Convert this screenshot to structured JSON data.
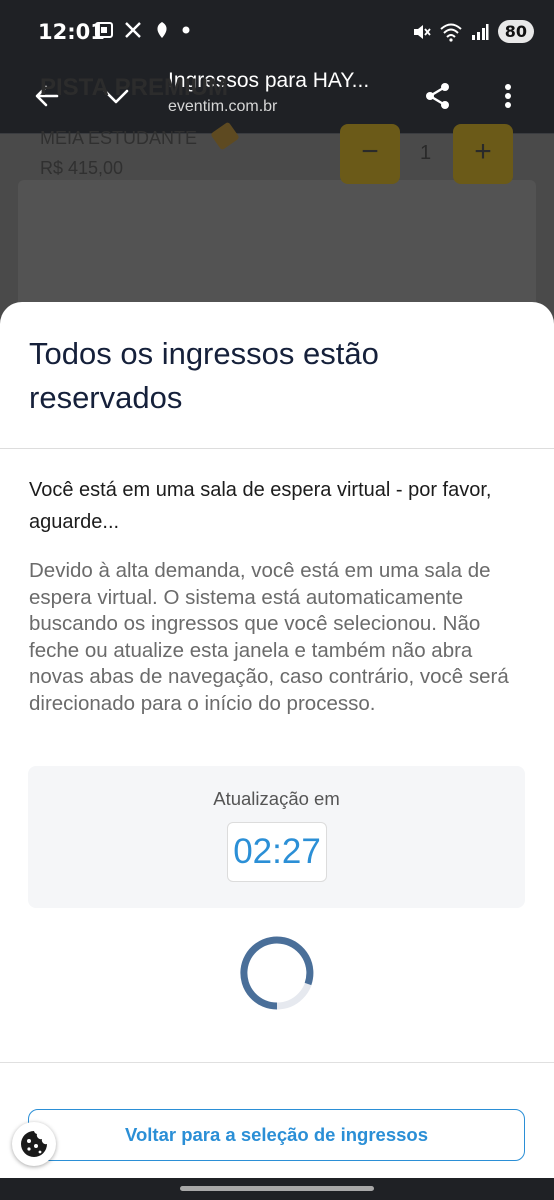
{
  "status_bar": {
    "time": "12:01",
    "battery": "80",
    "left_icons": [
      "screenshot-icon",
      "x-icon",
      "leaf-icon",
      "dot-icon"
    ],
    "right_icons": [
      "mute-icon",
      "wifi-icon",
      "signal-icon"
    ]
  },
  "toolbar": {
    "title": "Ingressos para HAY...",
    "url": "eventim.com.br"
  },
  "background_page": {
    "section": "PISTA PREMIUM",
    "ticket": "MEIA ESTUDANTE",
    "price": "R$ 415,00",
    "quantity": "1",
    "minus": "−",
    "plus": "+"
  },
  "modal": {
    "title": "Todos os ingressos estão reservados",
    "subtitle": "Você está em uma sala de espera virtual - por favor, aguarde...",
    "body": "Devido à alta demanda, você está em uma sala de espera virtual. O sistema está automaticamente buscando os ingressos que você selecionou. Não feche ou atualize esta janela e também não abra novas abas de navegação, caso contrário, você será direcionado para o início do processo.",
    "countdown_label": "Atualização em",
    "countdown": "02:27",
    "back_button": "Voltar para a seleção de ingressos"
  },
  "colors": {
    "accent": "#2b8fd6",
    "title": "#15203a",
    "spinner": "#4a6f99"
  }
}
